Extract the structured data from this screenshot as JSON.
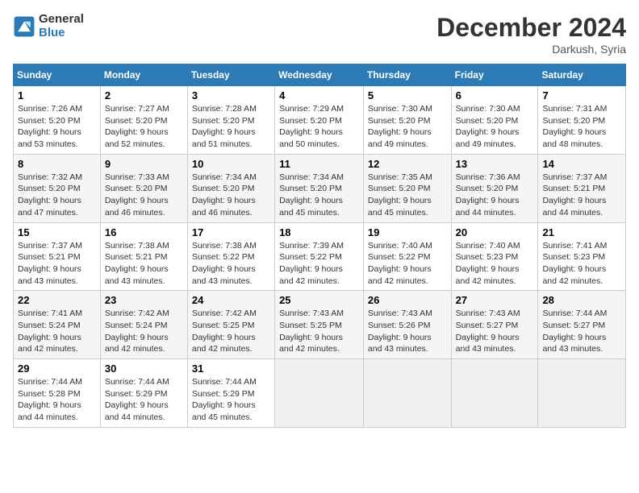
{
  "logo": {
    "general": "General",
    "blue": "Blue"
  },
  "title": "December 2024",
  "location": "Darkush, Syria",
  "weekdays": [
    "Sunday",
    "Monday",
    "Tuesday",
    "Wednesday",
    "Thursday",
    "Friday",
    "Saturday"
  ],
  "weeks": [
    [
      {
        "day": 1,
        "sunrise": "7:26 AM",
        "sunset": "5:20 PM",
        "daylight": "9 hours and 53 minutes."
      },
      {
        "day": 2,
        "sunrise": "7:27 AM",
        "sunset": "5:20 PM",
        "daylight": "9 hours and 52 minutes."
      },
      {
        "day": 3,
        "sunrise": "7:28 AM",
        "sunset": "5:20 PM",
        "daylight": "9 hours and 51 minutes."
      },
      {
        "day": 4,
        "sunrise": "7:29 AM",
        "sunset": "5:20 PM",
        "daylight": "9 hours and 50 minutes."
      },
      {
        "day": 5,
        "sunrise": "7:30 AM",
        "sunset": "5:20 PM",
        "daylight": "9 hours and 49 minutes."
      },
      {
        "day": 6,
        "sunrise": "7:30 AM",
        "sunset": "5:20 PM",
        "daylight": "9 hours and 49 minutes."
      },
      {
        "day": 7,
        "sunrise": "7:31 AM",
        "sunset": "5:20 PM",
        "daylight": "9 hours and 48 minutes."
      }
    ],
    [
      {
        "day": 8,
        "sunrise": "7:32 AM",
        "sunset": "5:20 PM",
        "daylight": "9 hours and 47 minutes."
      },
      {
        "day": 9,
        "sunrise": "7:33 AM",
        "sunset": "5:20 PM",
        "daylight": "9 hours and 46 minutes."
      },
      {
        "day": 10,
        "sunrise": "7:34 AM",
        "sunset": "5:20 PM",
        "daylight": "9 hours and 46 minutes."
      },
      {
        "day": 11,
        "sunrise": "7:34 AM",
        "sunset": "5:20 PM",
        "daylight": "9 hours and 45 minutes."
      },
      {
        "day": 12,
        "sunrise": "7:35 AM",
        "sunset": "5:20 PM",
        "daylight": "9 hours and 45 minutes."
      },
      {
        "day": 13,
        "sunrise": "7:36 AM",
        "sunset": "5:20 PM",
        "daylight": "9 hours and 44 minutes."
      },
      {
        "day": 14,
        "sunrise": "7:37 AM",
        "sunset": "5:21 PM",
        "daylight": "9 hours and 44 minutes."
      }
    ],
    [
      {
        "day": 15,
        "sunrise": "7:37 AM",
        "sunset": "5:21 PM",
        "daylight": "9 hours and 43 minutes."
      },
      {
        "day": 16,
        "sunrise": "7:38 AM",
        "sunset": "5:21 PM",
        "daylight": "9 hours and 43 minutes."
      },
      {
        "day": 17,
        "sunrise": "7:38 AM",
        "sunset": "5:22 PM",
        "daylight": "9 hours and 43 minutes."
      },
      {
        "day": 18,
        "sunrise": "7:39 AM",
        "sunset": "5:22 PM",
        "daylight": "9 hours and 42 minutes."
      },
      {
        "day": 19,
        "sunrise": "7:40 AM",
        "sunset": "5:22 PM",
        "daylight": "9 hours and 42 minutes."
      },
      {
        "day": 20,
        "sunrise": "7:40 AM",
        "sunset": "5:23 PM",
        "daylight": "9 hours and 42 minutes."
      },
      {
        "day": 21,
        "sunrise": "7:41 AM",
        "sunset": "5:23 PM",
        "daylight": "9 hours and 42 minutes."
      }
    ],
    [
      {
        "day": 22,
        "sunrise": "7:41 AM",
        "sunset": "5:24 PM",
        "daylight": "9 hours and 42 minutes."
      },
      {
        "day": 23,
        "sunrise": "7:42 AM",
        "sunset": "5:24 PM",
        "daylight": "9 hours and 42 minutes."
      },
      {
        "day": 24,
        "sunrise": "7:42 AM",
        "sunset": "5:25 PM",
        "daylight": "9 hours and 42 minutes."
      },
      {
        "day": 25,
        "sunrise": "7:43 AM",
        "sunset": "5:25 PM",
        "daylight": "9 hours and 42 minutes."
      },
      {
        "day": 26,
        "sunrise": "7:43 AM",
        "sunset": "5:26 PM",
        "daylight": "9 hours and 43 minutes."
      },
      {
        "day": 27,
        "sunrise": "7:43 AM",
        "sunset": "5:27 PM",
        "daylight": "9 hours and 43 minutes."
      },
      {
        "day": 28,
        "sunrise": "7:44 AM",
        "sunset": "5:27 PM",
        "daylight": "9 hours and 43 minutes."
      }
    ],
    [
      {
        "day": 29,
        "sunrise": "7:44 AM",
        "sunset": "5:28 PM",
        "daylight": "9 hours and 44 minutes."
      },
      {
        "day": 30,
        "sunrise": "7:44 AM",
        "sunset": "5:29 PM",
        "daylight": "9 hours and 44 minutes."
      },
      {
        "day": 31,
        "sunrise": "7:44 AM",
        "sunset": "5:29 PM",
        "daylight": "9 hours and 45 minutes."
      },
      null,
      null,
      null,
      null
    ]
  ],
  "labels": {
    "sunrise": "Sunrise:",
    "sunset": "Sunset:",
    "daylight": "Daylight:"
  }
}
